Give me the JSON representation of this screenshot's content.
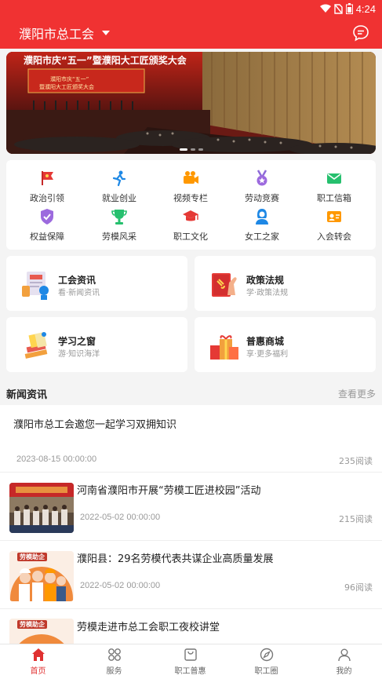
{
  "status": {
    "time": "4:24"
  },
  "header": {
    "city": "濮阳市总工会"
  },
  "banner": {
    "title": "濮阳市庆“五一”暨濮阳大工匠颁奖大会",
    "sign_line1": "濮阳市庆“五一”",
    "sign_line2": "暨濮阳大工匠颁奖大会"
  },
  "grid": [
    {
      "label": "政治引领",
      "icon": "flag-icon"
    },
    {
      "label": "就业创业",
      "icon": "runner-icon"
    },
    {
      "label": "视频专栏",
      "icon": "video-icon"
    },
    {
      "label": "劳动竞赛",
      "icon": "medal-icon"
    },
    {
      "label": "职工信箱",
      "icon": "mail-icon"
    },
    {
      "label": "权益保障",
      "icon": "shield-icon"
    },
    {
      "label": "劳模风采",
      "icon": "trophy-icon"
    },
    {
      "label": "职工文化",
      "icon": "graduation-cap-icon"
    },
    {
      "label": "女工之家",
      "icon": "woman-icon"
    },
    {
      "label": "入会转会",
      "icon": "id-card-icon"
    }
  ],
  "features": [
    {
      "title": "工会资讯",
      "subtitle": "看·新闻资讯",
      "icon": "newspaper-icon"
    },
    {
      "title": "政策法规",
      "subtitle": "学·政策法规",
      "icon": "law-book-icon"
    },
    {
      "title": "学习之窗",
      "subtitle": "游·知识海洋",
      "icon": "books-icon"
    },
    {
      "title": "普惠商城",
      "subtitle": "享·更多福利",
      "icon": "gift-icon"
    }
  ],
  "news": {
    "section_title": "新闻资讯",
    "more_label": "查看更多",
    "items": [
      {
        "title": "濮阳市总工会邀您一起学习双拥知识",
        "date": "2023-08-15 00:00:00",
        "reads": "235阅读"
      },
      {
        "title": "河南省濮阳市开展“劳模工匠进校园”活动",
        "date": "2022-05-02 00:00:00",
        "reads": "215阅读"
      },
      {
        "title": "濮阳县：29名劳模代表共谋企业高质量发展",
        "date": "2022-05-02 00:00:00",
        "reads": "96阅读"
      },
      {
        "title": "劳模走进市总工会职工夜校讲堂",
        "date": "",
        "reads": ""
      }
    ],
    "thumb_caption": "劳模助企"
  },
  "tabs": [
    {
      "label": "首页",
      "icon": "home-icon",
      "active": true
    },
    {
      "label": "服务",
      "icon": "grid-icon",
      "active": false
    },
    {
      "label": "职工普惠",
      "icon": "bag-icon",
      "active": false
    },
    {
      "label": "职工圈",
      "icon": "compass-icon",
      "active": false
    },
    {
      "label": "我的",
      "icon": "user-icon",
      "active": false
    }
  ],
  "colors": {
    "brand_red": "#f03232",
    "active_tab": "#e03131"
  }
}
